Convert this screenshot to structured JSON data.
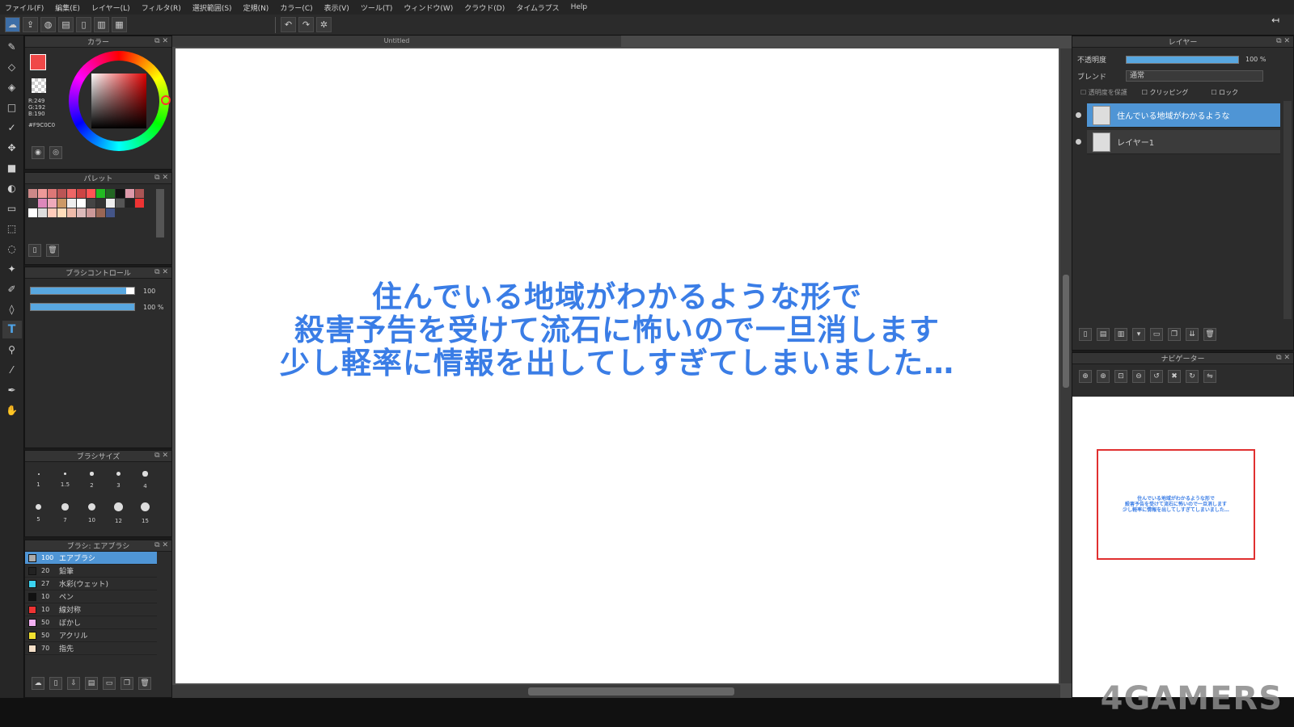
{
  "menu": [
    "ファイル(F)",
    "編集(E)",
    "レイヤー(L)",
    "フィルタ(R)",
    "選択範囲(S)",
    "定規(N)",
    "カラー(C)",
    "表示(V)",
    "ツール(T)",
    "ウィンドウ(W)",
    "クラウド(D)",
    "タイムラプス",
    "Help"
  ],
  "toolbar": {
    "icons": [
      "cloud-icon",
      "share-icon",
      "speech-icon",
      "comic-icon",
      "page-icon",
      "panel-icon",
      "grid-icon"
    ],
    "undo": "↶",
    "redo": "↷"
  },
  "color_panel": {
    "title": "カラー",
    "r": "R:249",
    "g": "G:192",
    "b": "B:190",
    "hex": "#F9C0C0",
    "primary": "#f04848",
    "accent": "#ff3030"
  },
  "palette_panel": {
    "title": "パレット",
    "swatches": [
      "#c88",
      "#e99",
      "#d77",
      "#b55",
      "#e66",
      "#c44",
      "#f55",
      "#2b2",
      "#262",
      "#111",
      "#d9a",
      "#a55",
      "#333",
      "#d8b",
      "#eab",
      "#c96",
      "#eee",
      "#fff",
      "#444",
      "#333",
      "#eee",
      "#555",
      "#222",
      "#e33",
      "#fff",
      "#ddd",
      "#fcb",
      "#fdb",
      "#eba",
      "#dbb",
      "#c99",
      "#965",
      "#458"
    ]
  },
  "brush_control": {
    "title": "ブラシコントロール",
    "size": "100",
    "opacity": "100 %"
  },
  "brush_size": {
    "title": "ブラシサイズ",
    "sizes": [
      "1",
      "1.5",
      "2",
      "3",
      "4",
      "5",
      "7",
      "10",
      "12",
      "15"
    ]
  },
  "brush_list": {
    "title": "ブラシ: エアブラシ",
    "items": [
      {
        "num": "100",
        "name": "エアブラシ",
        "color": "#aaa"
      },
      {
        "num": "20",
        "name": "鉛筆",
        "color": "#222"
      },
      {
        "num": "27",
        "name": "水彩(ウェット)",
        "color": "#3bd3f0"
      },
      {
        "num": "10",
        "name": "ペン",
        "color": "#111"
      },
      {
        "num": "10",
        "name": "線対称",
        "color": "#e33"
      },
      {
        "num": "50",
        "name": "ぼかし",
        "color": "#f3b0f3"
      },
      {
        "num": "50",
        "name": "アクリル",
        "color": "#f0e030"
      },
      {
        "num": "70",
        "name": "指先",
        "color": "#f5e0c8"
      }
    ]
  },
  "canvas": {
    "tab": "Untitled",
    "lines": [
      "住んでいる地域がわかるような形で",
      "殺害予告を受けて流石に怖いので一旦消します",
      "少し軽率に情報を出してしすぎてしまいました…"
    ]
  },
  "layer_panel": {
    "title": "レイヤー",
    "opacity_label": "不透明度",
    "opacity_value": "100 %",
    "blend_label": "ブレンド",
    "blend_value": "通常",
    "protect": "透明度を保護",
    "clipping": "クリッピング",
    "lock": "ロック",
    "layers": [
      {
        "name": "住んでいる地域がわかるような",
        "selected": true
      },
      {
        "name": "レイヤー1",
        "selected": false
      }
    ]
  },
  "navigator": {
    "title": "ナビゲーター"
  },
  "watermark": "4GAMERS"
}
